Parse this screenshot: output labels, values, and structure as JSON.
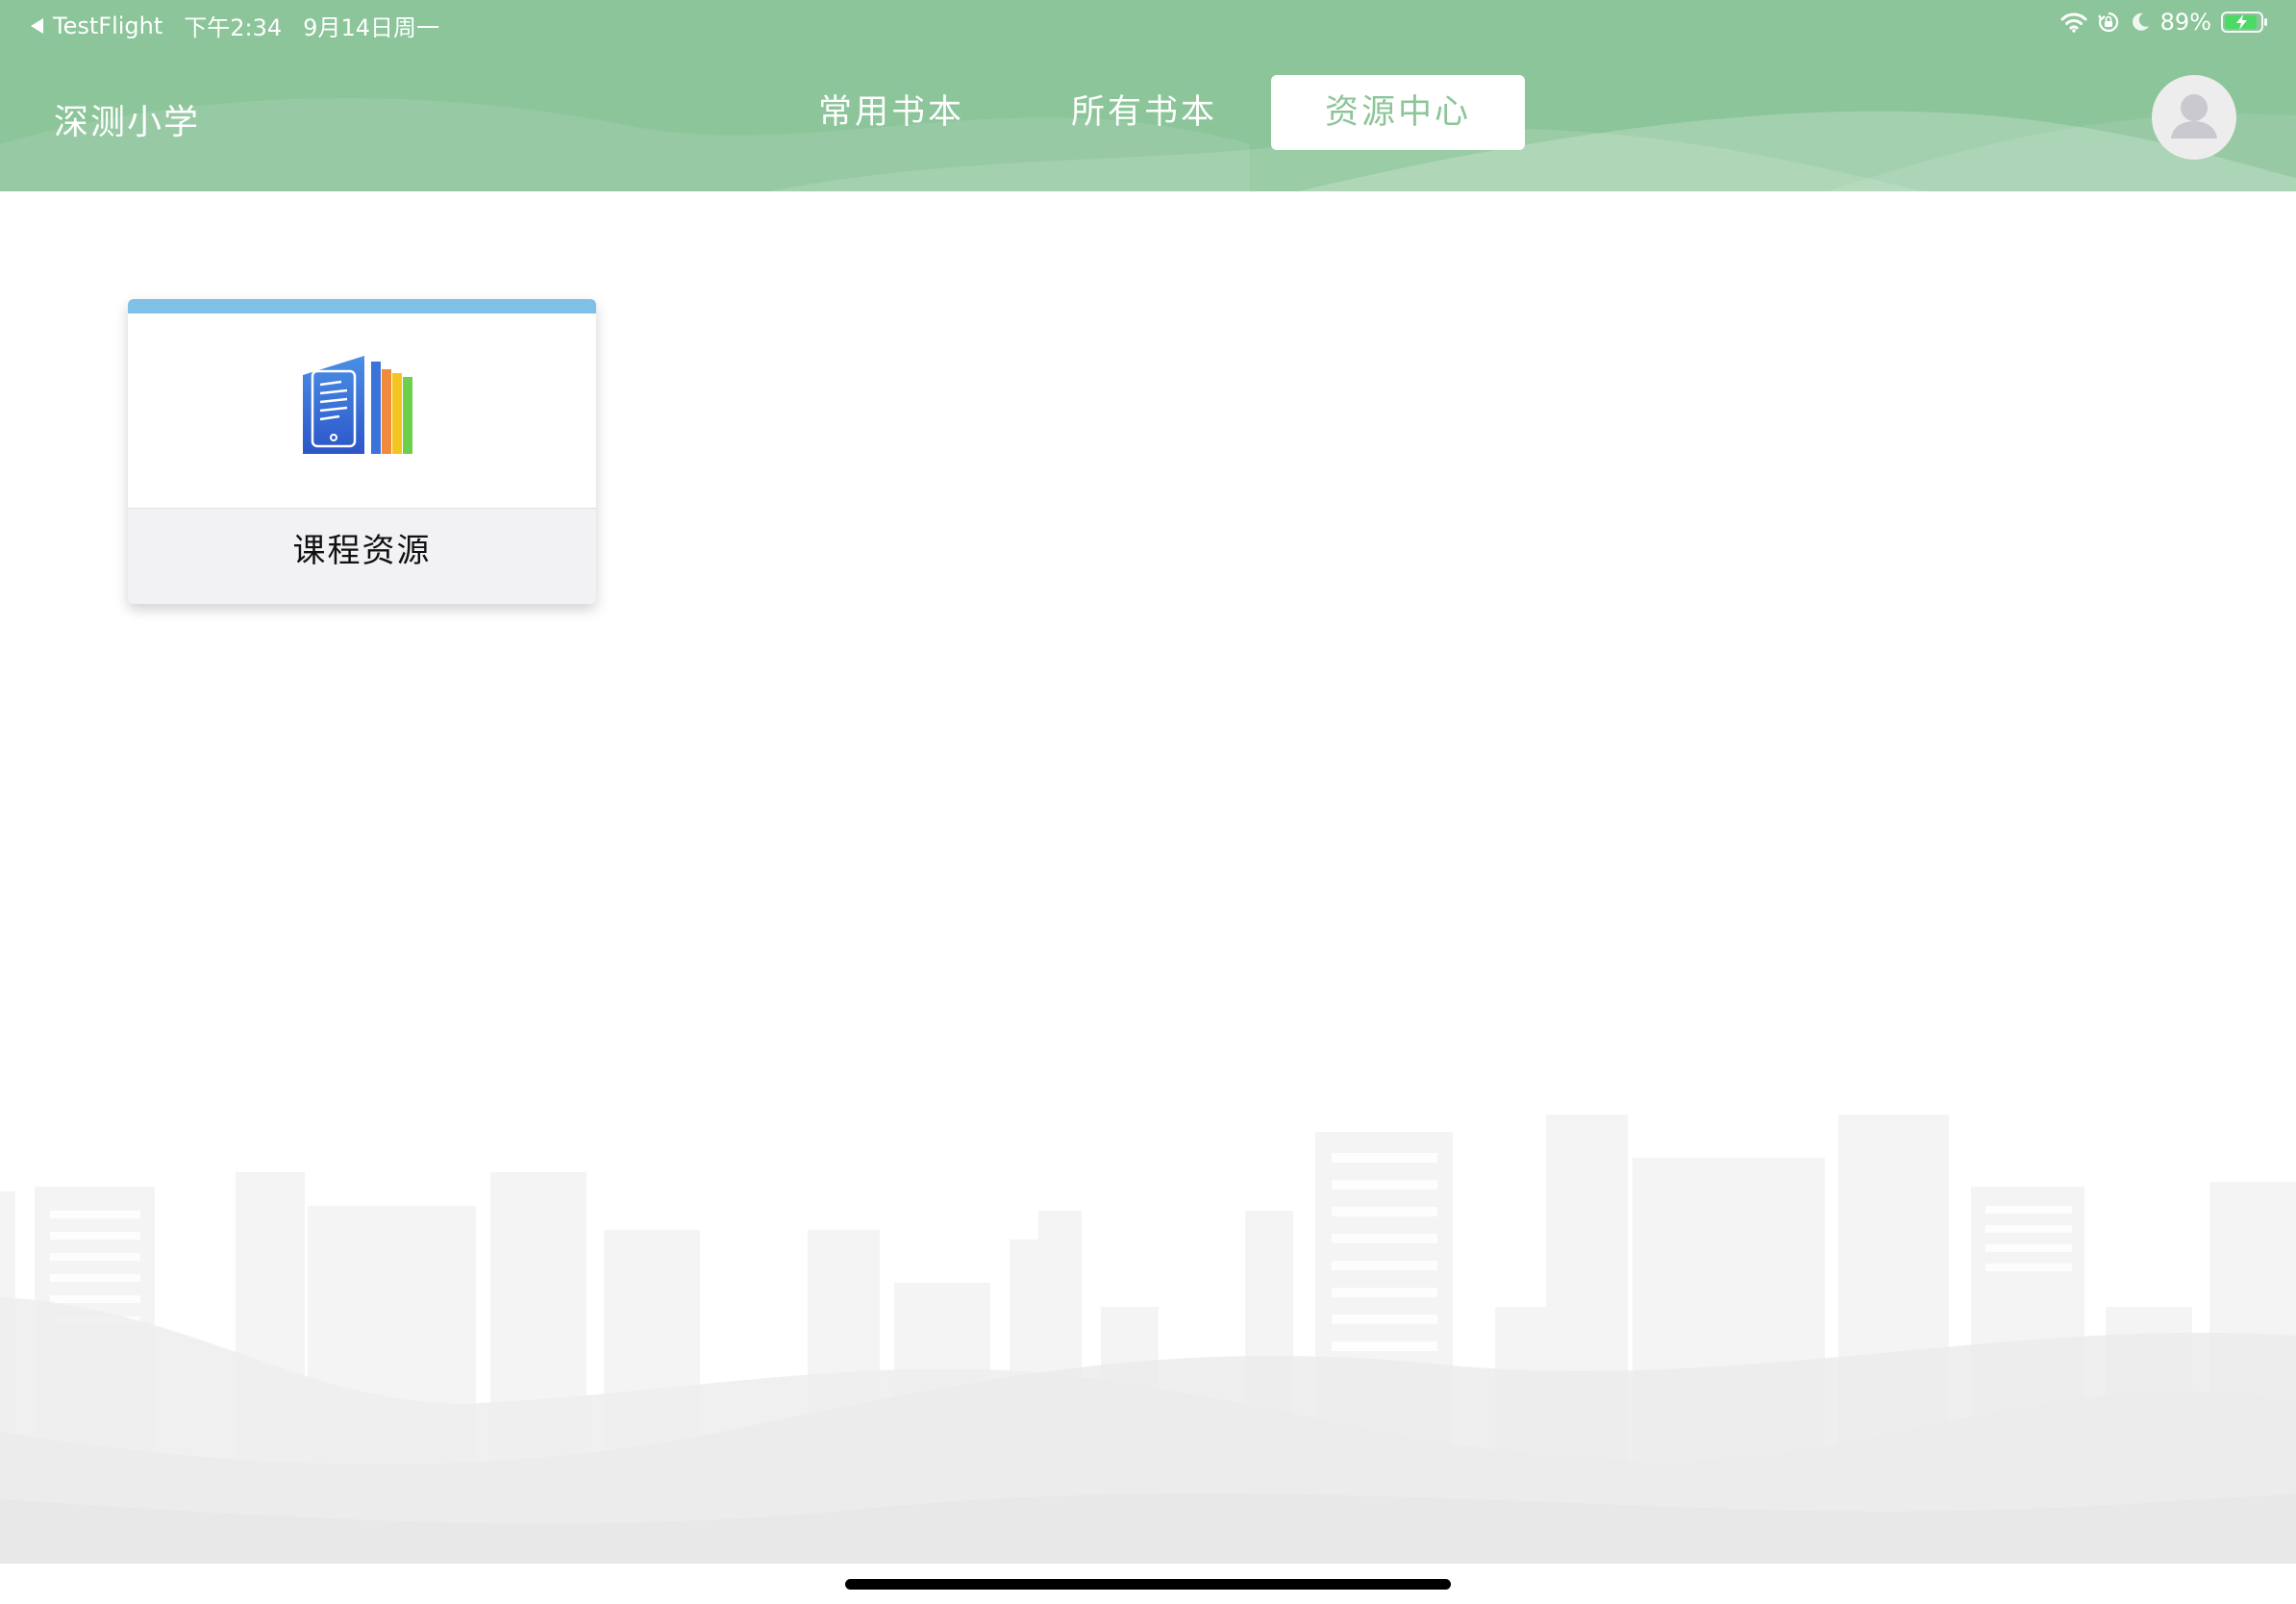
{
  "status_bar": {
    "back_app": "TestFlight",
    "time": "下午2:34",
    "date": "9月14日周一",
    "battery_percent": "89%",
    "icons": [
      "wifi-icon",
      "orientation-lock-icon",
      "moon-icon",
      "battery-charging-icon"
    ]
  },
  "header": {
    "school_name": "深测小学",
    "tabs": [
      {
        "label": "常用书本",
        "active": false
      },
      {
        "label": "所有书本",
        "active": false
      },
      {
        "label": "资源中心",
        "active": true
      }
    ],
    "avatar_icon": "user-avatar-icon"
  },
  "colors": {
    "header_green": "#8cc59a",
    "card_accent_blue": "#7fc0e6",
    "card_footer_bg": "#f2f2f5"
  },
  "main": {
    "cards": [
      {
        "title": "课程资源",
        "icon": "course-resources-books-icon"
      }
    ]
  }
}
